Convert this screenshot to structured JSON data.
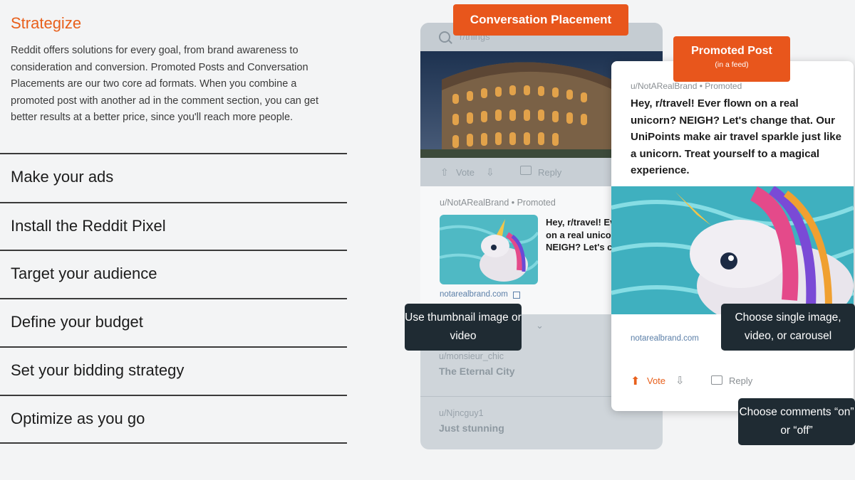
{
  "strategize": {
    "title": "Strategize",
    "description": "Reddit offers solutions for every goal, from brand awareness to consideration and conversion. Promoted Posts and Conversation Placements are our two core ad formats. When you combine a promoted post with another ad in the comment section, you can get better results at a better price, since you'll reach more people."
  },
  "steps": [
    {
      "label": "Make your ads"
    },
    {
      "label": "Install the Reddit Pixel"
    },
    {
      "label": "Target your audience"
    },
    {
      "label": "Define your budget"
    },
    {
      "label": "Set your bidding strategy"
    },
    {
      "label": "Optimize as you go"
    }
  ],
  "labels": {
    "conversation_placement": "Conversation Placement",
    "promoted_post": "Promoted Post",
    "promoted_post_sub": "(in a feed)"
  },
  "back_card": {
    "subreddit": "r/things",
    "vote": "Vote",
    "reply": "Reply",
    "promo_user": "u/NotARealBrand • Promoted",
    "promo_text": "Hey, r/travel! Ever flown on a real unicorn? NEIGH? Let's change that.",
    "promo_link": "notarealbrand.com",
    "comments": [
      {
        "user": "u/monsieur_chic",
        "text": "The Eternal City"
      },
      {
        "user": "u/Njncguy1",
        "text": "Just stunning"
      }
    ]
  },
  "front_card": {
    "user": "u/NotARealBrand • Promoted",
    "text": "Hey, r/travel! Ever flown on a real unicorn? NEIGH? Let's change that. Our UniPoints make air travel sparkle just like a unicorn. Treat yourself to a magical experience.",
    "link": "notarealbrand.com",
    "vote": "Vote",
    "reply": "Reply"
  },
  "tooltips": {
    "thumbnail": "Use thumbnail image or video",
    "single": "Choose single image, video, or carousel",
    "comments": "Choose comments “on” or “off”"
  },
  "colors": {
    "accent": "#e8561c",
    "tooltip_bg": "#1f2b33",
    "page_bg": "#f3f4f5"
  }
}
